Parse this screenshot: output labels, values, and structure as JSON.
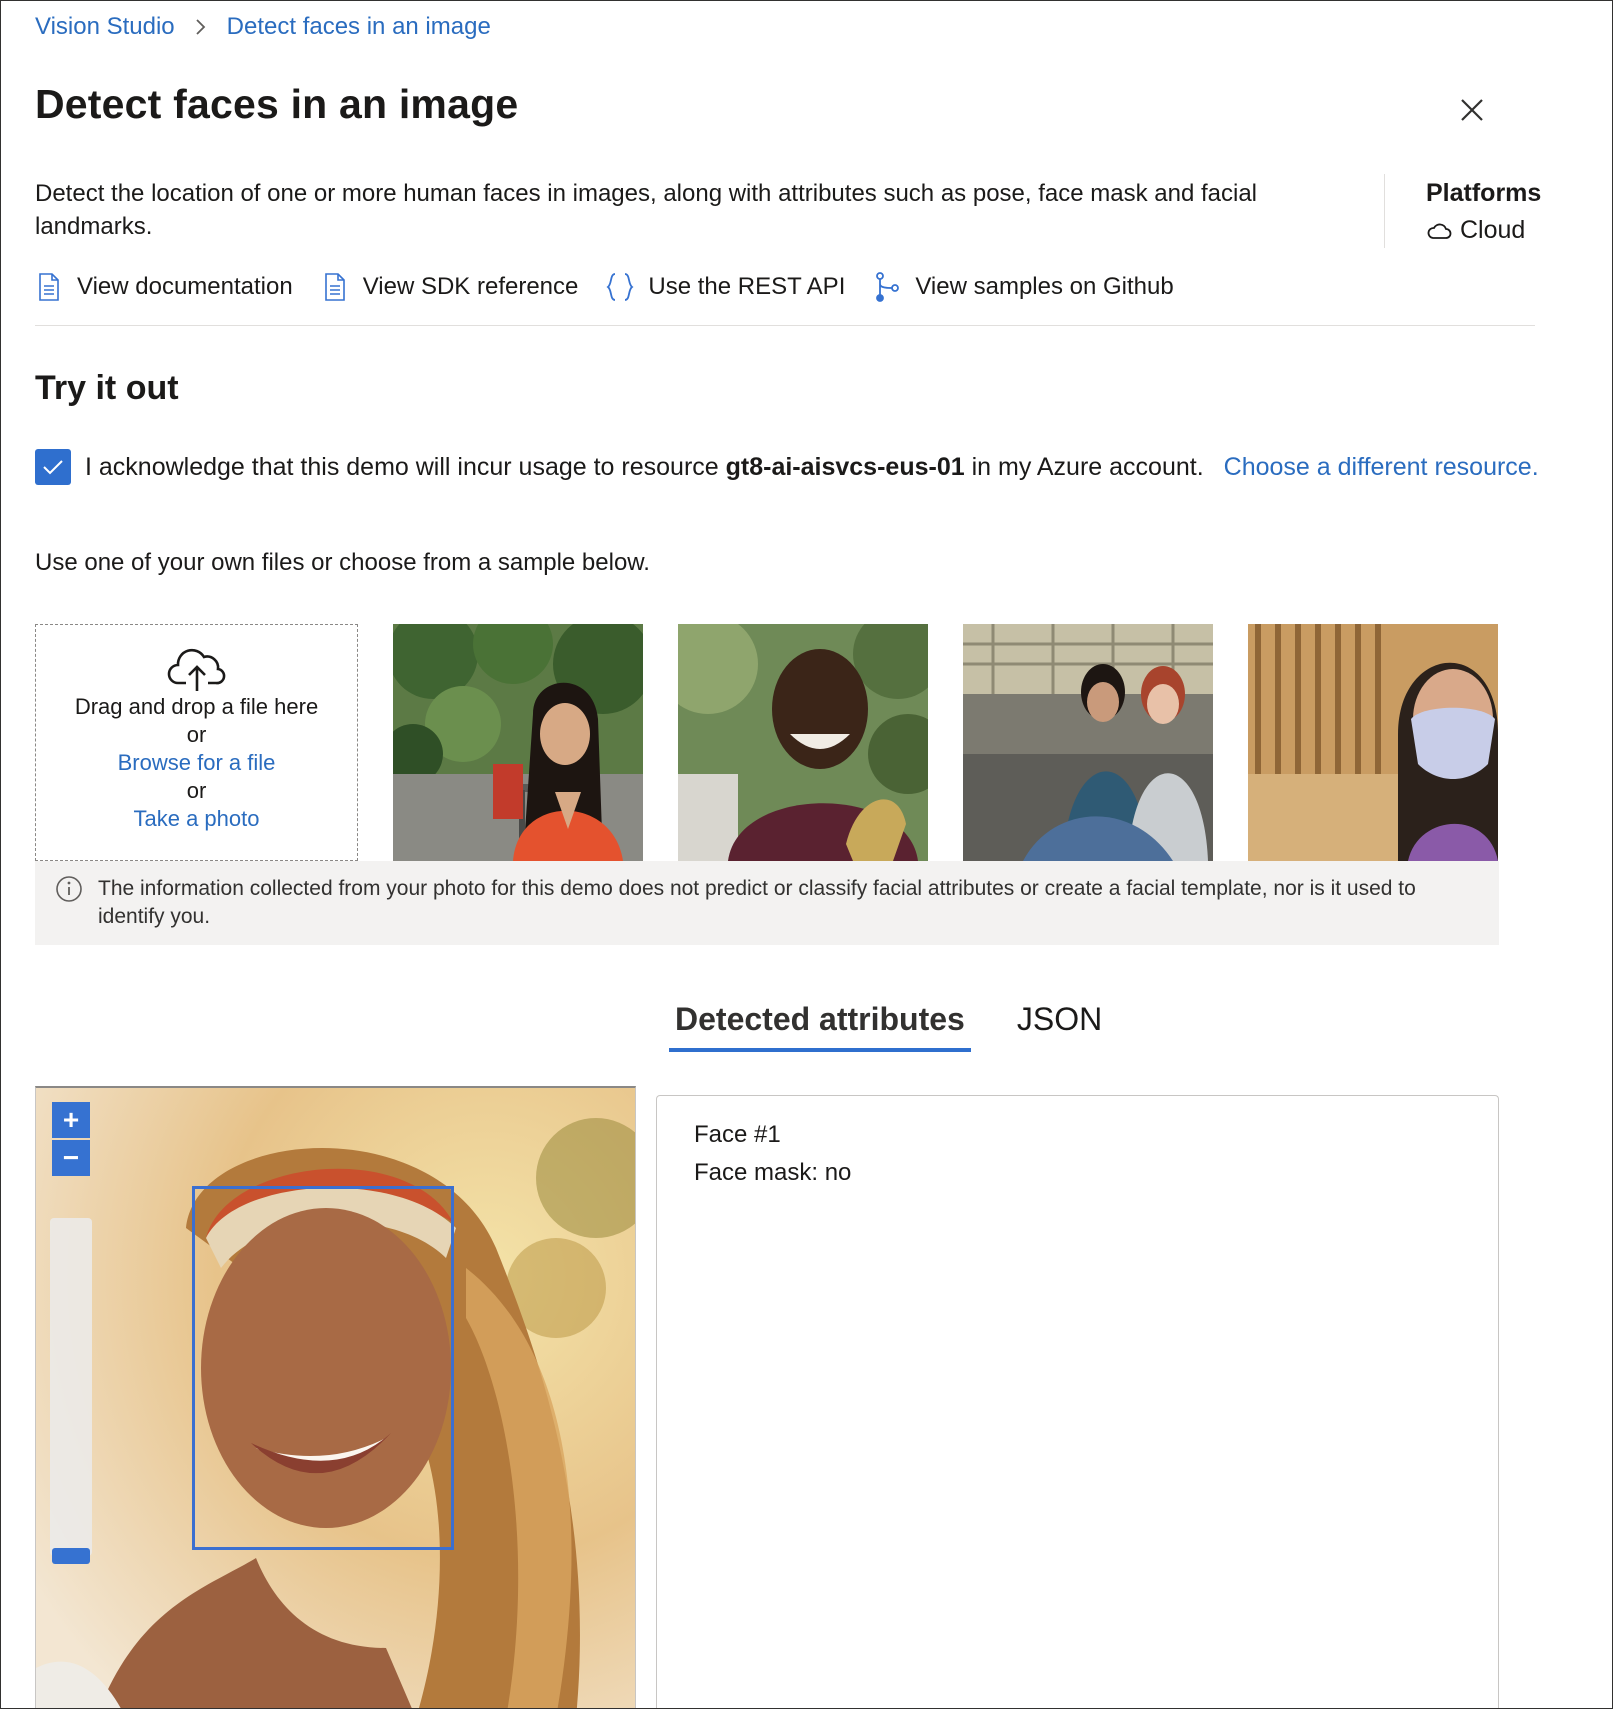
{
  "breadcrumb": {
    "root": "Vision Studio",
    "current": "Detect faces in an image"
  },
  "header": {
    "title": "Detect faces in an image"
  },
  "description": "Detect the location of one or more human faces in images, along with attributes such as pose, face mask and facial landmarks.",
  "platforms": {
    "label": "Platforms",
    "value": "Cloud"
  },
  "links": [
    {
      "label": "View documentation",
      "icon": "document-icon"
    },
    {
      "label": "View SDK reference",
      "icon": "document-icon"
    },
    {
      "label": "Use the REST API",
      "icon": "braces-icon"
    },
    {
      "label": "View samples on Github",
      "icon": "branch-icon"
    }
  ],
  "try_it": {
    "title": "Try it out",
    "ack_prefix": "I acknowledge that this demo will incur usage to resource ",
    "resource": "gt8-ai-aisvcs-eus-01",
    "ack_suffix": " in my Azure account.",
    "choose_link": "Choose a different resource.",
    "acknowledged": true
  },
  "upload": {
    "instruction": "Use one of your own files or choose from a sample below.",
    "drag_text": "Drag and drop a file here",
    "or1": "or",
    "browse": "Browse for a file",
    "or2": "or",
    "photo": "Take a photo"
  },
  "notice": "The information collected from your photo for this demo does not predict or classify facial attributes or create a facial template, nor is it used to identify you.",
  "tabs": {
    "detected": "Detected attributes",
    "json": "JSON",
    "active": "Detected attributes"
  },
  "results": {
    "face_label": "Face #1",
    "face_mask": "Face mask: no"
  },
  "colors": {
    "accent": "#2f6fce",
    "link": "#2a6cbf",
    "notice_bg": "#f3f2f1"
  }
}
